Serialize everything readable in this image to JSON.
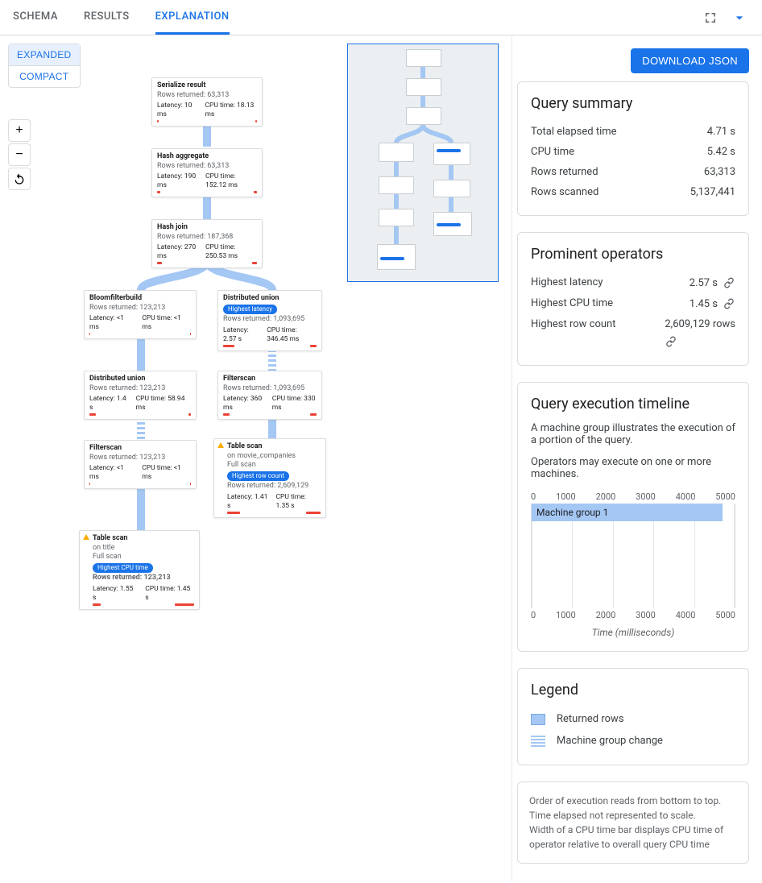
{
  "tabs": {
    "schema": "SCHEMA",
    "results": "RESULTS",
    "explanation": "EXPLANATION"
  },
  "view_modes": {
    "expanded": "EXPANDED",
    "compact": "COMPACT"
  },
  "download_label": "DOWNLOAD JSON",
  "plan": {
    "serialize": {
      "title": "Serialize result",
      "rows": "Rows returned: 63,313",
      "lat": "Latency: 10 ms",
      "cpu": "CPU time: 18.13 ms"
    },
    "hashagg": {
      "title": "Hash aggregate",
      "rows": "Rows returned: 63,313",
      "lat": "Latency: 190 ms",
      "cpu": "CPU time: 152.12 ms"
    },
    "hashjoin": {
      "title": "Hash join",
      "rows": "Rows returned: 187,368",
      "lat": "Latency: 270 ms",
      "cpu": "CPU time: 250.53 ms"
    },
    "bloom": {
      "title": "Bloomfilterbuild",
      "rows": "Rows returned: 123,213",
      "lat": "Latency: <1 ms",
      "cpu": "CPU time: <1 ms"
    },
    "du_right": {
      "title": "Distributed union",
      "badge": "Highest latency",
      "rows": "Rows returned: 1,093,695",
      "lat": "Latency: 2.57 s",
      "cpu": "CPU time: 346.45 ms"
    },
    "du_left": {
      "title": "Distributed union",
      "rows": "Rows returned: 123,213",
      "lat": "Latency: 1.4 s",
      "cpu": "CPU time: 58.94 ms"
    },
    "fs_right": {
      "title": "Filterscan",
      "rows": "Rows returned: 1,093,695",
      "lat": "Latency: 360 ms",
      "cpu": "CPU time: 330 ms"
    },
    "fs_left": {
      "title": "Filterscan",
      "rows": "Rows returned: 123,213",
      "lat": "Latency: <1 ms",
      "cpu": "CPU time: <1 ms"
    },
    "ts_right": {
      "title": "Table scan",
      "on": "on movie_companies",
      "full": "Full scan",
      "badge": "Highest row count",
      "rows": "Rows returned: 2,609,129",
      "lat": "Latency: 1.41 s",
      "cpu": "CPU time: 1.35 s"
    },
    "ts_left": {
      "title": "Table scan",
      "on": "on title",
      "full": "Full scan",
      "badge": "Highest CPU time",
      "rows": "Rows returned: 123,213",
      "lat": "Latency: 1.55 s",
      "cpu": "CPU time: 1.45 s"
    }
  },
  "summary": {
    "heading": "Query summary",
    "rows": [
      {
        "k": "Total elapsed time",
        "v": "4.71 s"
      },
      {
        "k": "CPU time",
        "v": "5.42 s"
      },
      {
        "k": "Rows returned",
        "v": "63,313"
      },
      {
        "k": "Rows scanned",
        "v": "5,137,441"
      }
    ]
  },
  "prominent": {
    "heading": "Prominent operators",
    "rows": [
      {
        "k": "Highest latency",
        "v": "2.57 s",
        "link": true
      },
      {
        "k": "Highest CPU time",
        "v": "1.45 s",
        "link": true
      },
      {
        "k": "Highest row count",
        "v": "2,609,129 rows",
        "link": true
      }
    ]
  },
  "timeline": {
    "heading": "Query execution timeline",
    "desc1": "A machine group illustrates the execution of a portion of the query.",
    "desc2": "Operators may execute on one or more machines.",
    "ticks": [
      "0",
      "1000",
      "2000",
      "3000",
      "4000",
      "5000"
    ],
    "bar_label": "Machine group 1",
    "xlabel": "Time (milliseconds)"
  },
  "legend": {
    "heading": "Legend",
    "returned": "Returned rows",
    "mgc": "Machine group change"
  },
  "footnote": {
    "l1": "Order of execution reads from bottom to top.",
    "l2": "Time elapsed not represented to scale.",
    "l3": "Width of a CPU time bar displays CPU time of operator relative to overall query CPU time"
  },
  "chart_data": {
    "type": "bar",
    "orientation": "horizontal",
    "title": "Query execution timeline",
    "xlabel": "Time (milliseconds)",
    "xlim": [
      0,
      5000
    ],
    "ticks": [
      0,
      1000,
      2000,
      3000,
      4000,
      5000
    ],
    "series": [
      {
        "name": "Machine group 1",
        "start": 0,
        "end": 4700
      }
    ]
  }
}
